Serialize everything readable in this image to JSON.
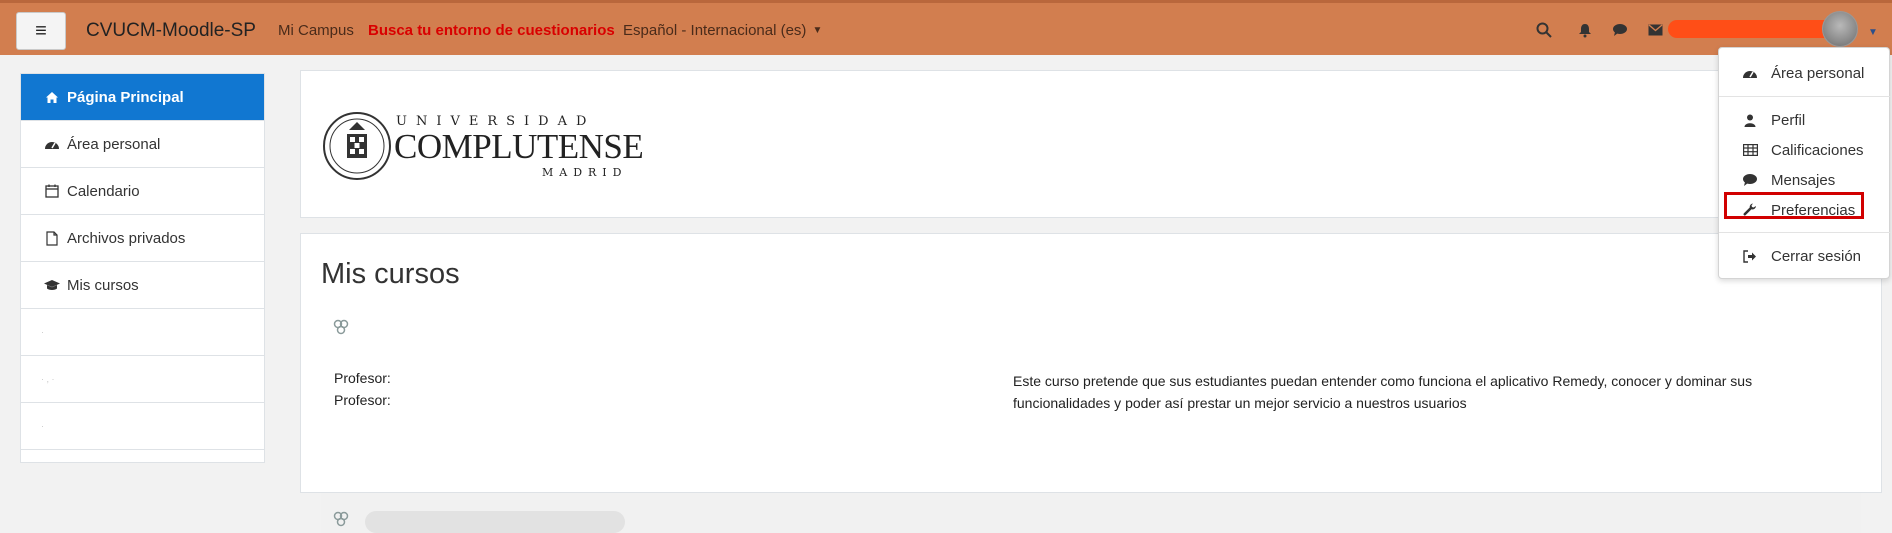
{
  "topbar": {
    "brand": "CVUCM-Moodle-SP",
    "links": [
      "Mi Campus",
      "Busca tu entorno de cuestionarios"
    ],
    "language": "Español - Internacional (es)"
  },
  "icons": {
    "menu": "hamburger-menu-icon",
    "search": "search-icon",
    "notifications": "bell-icon",
    "messages": "chat-bubble-icon",
    "mail": "envelope-icon"
  },
  "sidebar": {
    "items": [
      {
        "label": "Página Principal",
        "icon": "home-icon"
      },
      {
        "label": "Área personal",
        "icon": "dashboard-icon"
      },
      {
        "label": "Calendario",
        "icon": "calendar-icon"
      },
      {
        "label": "Archivos privados",
        "icon": "file-icon"
      },
      {
        "label": "Mis cursos",
        "icon": "graduation-cap-icon"
      }
    ]
  },
  "logo": {
    "line1": "UNIVERSIDAD",
    "line2": "COMPLUTENSE",
    "line3": "MADRID"
  },
  "courses": {
    "title": "Mis cursos",
    "professor_label": "Profesor:",
    "summary": "Este curso pretende que sus estudiantes puedan entender como funciona el aplicativo Remedy, conocer y dominar sus funcionalidades y poder así prestar un mejor servicio a nuestros usuarios"
  },
  "user_menu": {
    "items": [
      {
        "label": "Área personal",
        "icon": "dashboard-icon"
      },
      {
        "label": "Perfil",
        "icon": "user-icon"
      },
      {
        "label": "Calificaciones",
        "icon": "table-icon"
      },
      {
        "label": "Mensajes",
        "icon": "chat-bubble-icon"
      },
      {
        "label": "Preferencias",
        "icon": "wrench-icon"
      },
      {
        "label": "Cerrar sesión",
        "icon": "sign-out-icon"
      }
    ]
  },
  "colors": {
    "topbar": "#d27e4f",
    "active": "#1177d1",
    "highlight": "#d10000"
  }
}
